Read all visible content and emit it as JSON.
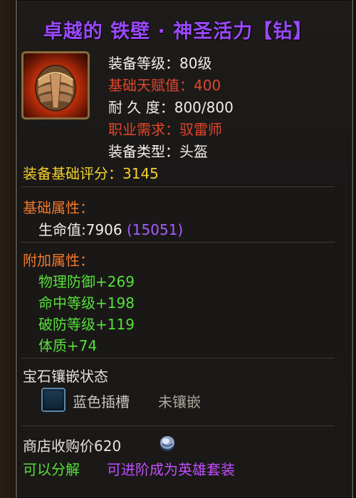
{
  "item": {
    "title": "卓越的 铁壁 · 神圣活力【钻】",
    "equip_level": "装备等级：80级",
    "base_talent": "基础天赋值：400",
    "durability": "耐 久 度：800/800",
    "class_req": "职业需求：驭雷师",
    "equip_type": "装备类型：头盔",
    "base_score": "装备基础评分：3145"
  },
  "base_attributes": {
    "heading": "基础属性：",
    "hp_label": "生命值:7906",
    "hp_extra": "(15051)"
  },
  "extra_attributes": {
    "heading": "附加属性：",
    "items": [
      "物理防御+269",
      "命中等级+198",
      "破防等级+119",
      "体质+74"
    ]
  },
  "gem": {
    "heading": "宝石镶嵌状态",
    "slot_color": "蓝色插槽",
    "slot_status": "未镶嵌"
  },
  "footer": {
    "shop_price": "商店收购价620",
    "decompose": "可以分解",
    "upgrade": "可进阶成为英雄套装"
  },
  "colors": {
    "title": "#9b49ff",
    "white": "#f2efe8",
    "red": "#e0452b",
    "yellow": "#f3d02a",
    "orange": "#f3782a",
    "green": "#56e03a",
    "purple": "#a85cff"
  },
  "icons": {
    "item": "helmet-icon",
    "gem_slot": "blue-socket-icon",
    "currency": "silver-coin-icon"
  }
}
